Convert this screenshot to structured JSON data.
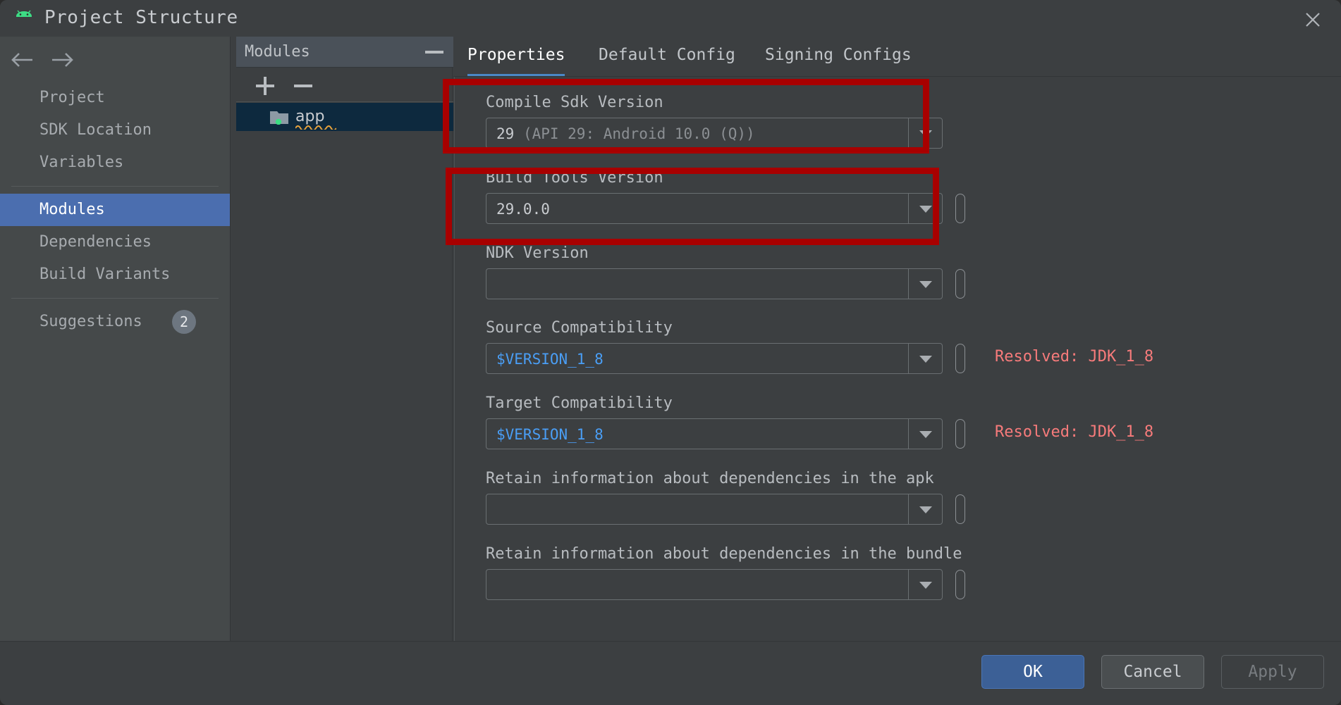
{
  "window": {
    "title": "Project Structure",
    "app_icon": "android-robot-icon",
    "close_icon": "close-icon"
  },
  "sidebar": {
    "back_icon": "arrow-left-icon",
    "forward_icon": "arrow-right-icon",
    "items": [
      {
        "label": "Project",
        "selected": false
      },
      {
        "label": "SDK Location",
        "selected": false
      },
      {
        "label": "Variables",
        "selected": false
      },
      {
        "label": "Modules",
        "selected": true
      },
      {
        "label": "Dependencies",
        "selected": false
      },
      {
        "label": "Build Variants",
        "selected": false
      },
      {
        "label": "Suggestions",
        "selected": false,
        "badge": "2"
      }
    ]
  },
  "modules_panel": {
    "title": "Modules",
    "collapse_icon": "minus-icon",
    "add_icon": "plus-icon",
    "remove_icon": "minus-icon",
    "modules": [
      {
        "name": "app",
        "icon": "folder-icon",
        "selected": true,
        "warning": true
      }
    ]
  },
  "tabs": [
    {
      "label": "Properties",
      "active": true
    },
    {
      "label": "Default Config",
      "active": false
    },
    {
      "label": "Signing Configs",
      "active": false
    }
  ],
  "form": {
    "fields": [
      {
        "label": "Compile Sdk Version",
        "value_strong": "29",
        "value_dim": " (API 29: Android 10.0 (Q))",
        "has_var_pill": false,
        "resolved": "",
        "highlighted": true
      },
      {
        "label": "Build Tools Version",
        "value_strong": "29.0.0",
        "value_dim": "",
        "has_var_pill": true,
        "resolved": "",
        "highlighted": true
      },
      {
        "label": "NDK Version",
        "value_strong": "",
        "value_dim": "",
        "has_var_pill": true,
        "resolved": "",
        "highlighted": false
      },
      {
        "label": "Source Compatibility",
        "value_strong": "$VERSION_1_8",
        "value_dim": "",
        "is_variable": true,
        "has_var_pill": true,
        "resolved": "Resolved: JDK_1_8",
        "highlighted": false
      },
      {
        "label": "Target Compatibility",
        "value_strong": "$VERSION_1_8",
        "value_dim": "",
        "is_variable": true,
        "has_var_pill": true,
        "resolved": "Resolved: JDK_1_8",
        "highlighted": false
      },
      {
        "label": "Retain information about dependencies in the apk",
        "value_strong": "",
        "value_dim": "",
        "has_var_pill": true,
        "resolved": "",
        "highlighted": false
      },
      {
        "label": "Retain information about dependencies in the bundle",
        "value_strong": "",
        "value_dim": "",
        "has_var_pill": true,
        "resolved": "",
        "highlighted": false
      }
    ]
  },
  "footer": {
    "ok_label": "OK",
    "cancel_label": "Cancel",
    "apply_label": "Apply"
  },
  "colors": {
    "accent": "#4b6eaf",
    "annotation": "#a80000",
    "variable_text": "#4a9ef5",
    "resolved_text": "#f77b7b",
    "window_bg": "#3c3f41",
    "sidebar_bg": "#45494a",
    "selected_module_bg": "#0d293e"
  }
}
